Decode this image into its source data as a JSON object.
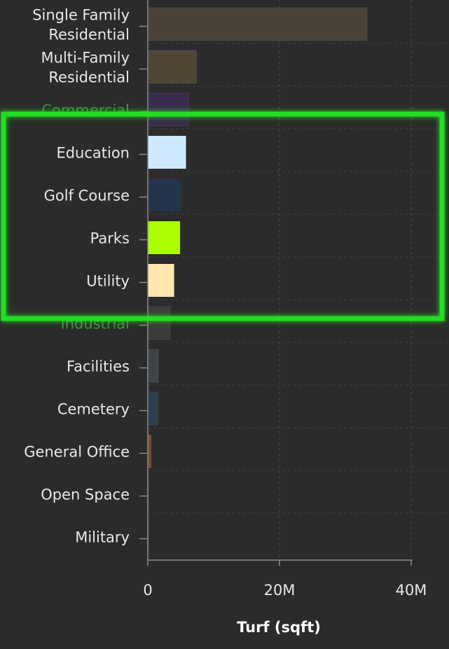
{
  "chart_data": {
    "type": "bar",
    "orientation": "horizontal",
    "categories": [
      [
        "Single Family",
        "Residential"
      ],
      [
        "Multi-Family",
        "Residential"
      ],
      [
        "Commercial"
      ],
      [
        "Education"
      ],
      [
        "Golf Course"
      ],
      [
        "Parks"
      ],
      [
        "Utility"
      ],
      [
        "Industrial"
      ],
      [
        "Facilities"
      ],
      [
        "Cemetery"
      ],
      [
        "General Office"
      ],
      [
        "Open Space"
      ],
      [
        "Military"
      ]
    ],
    "values": [
      33300000,
      7400000,
      6200000,
      5800000,
      5000000,
      4900000,
      4000000,
      3400000,
      1600000,
      1500000,
      500000,
      100000,
      50000
    ],
    "bar_colors": [
      "#4a4239",
      "#4e4535",
      "#3a2d4d",
      "#cfeaff",
      "#24344a",
      "#aaff00",
      "#ffe7ad",
      "#3b3b3b",
      "#3f4347",
      "#2a3f50",
      "#7a4a35",
      "#444444",
      "#444444"
    ],
    "highlighted": [
      false,
      false,
      false,
      true,
      true,
      true,
      true,
      false,
      false,
      false,
      false,
      false,
      false
    ],
    "xlabel": "Turf (sqft)",
    "xlim": [
      0,
      40000000
    ],
    "xticks": [
      0,
      20000000,
      40000000
    ],
    "xtick_labels": [
      "0",
      "20M",
      "40M"
    ],
    "grid": true,
    "dimmed_label_color": "#3f8f3f",
    "label_color": "#e8e8e8",
    "highlight_border_color": "#22dd22"
  }
}
